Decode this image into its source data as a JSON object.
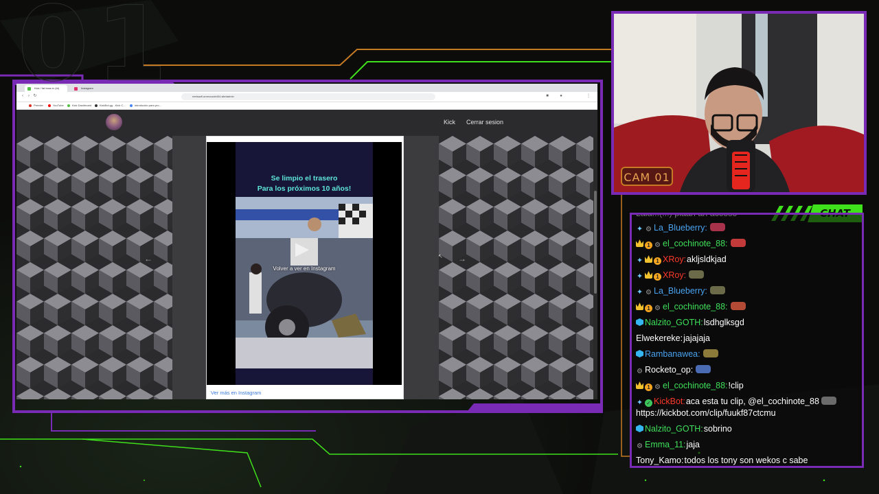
{
  "stream": {
    "overlay_number": "01",
    "cam_label": "CAM 01",
    "chat_title": "CHAT"
  },
  "browser": {
    "tabs": [
      {
        "label": "Kick / fat boss tv (bi)",
        "favicon_color": "#53c146"
      },
      {
        "label": "Instagram",
        "favicon_color": "#e1306c"
      }
    ],
    "url": "reelsazfl.unreccode404.site/admin",
    "bookmarks": [
      {
        "label": "Premier",
        "icon_color": "#d93025"
      },
      {
        "label": "YouTube",
        "icon_color": "#ff0000"
      },
      {
        "label": "Kick Dashboard",
        "icon_color": "#53c146"
      },
      {
        "label": "KickBot.gg - Kick C...",
        "icon_color": "#333333"
      },
      {
        "label": "introducido para pro...",
        "icon_color": "#4285f4"
      }
    ]
  },
  "site": {
    "nav": {
      "kick_link": "Kick",
      "logout_link": "Cerrar sesion"
    },
    "embed": {
      "video_title_line1": "Se limpio el trasero",
      "video_title_line2": "Para los próximos 10 años!",
      "watch_again": "Volver a ver en Instagram",
      "see_more": "Ver más en Instagram"
    },
    "prev_arrow": "←",
    "next_arrow": "→"
  },
  "chat": {
    "partial_top": "Lala...(...) plaan ah acceso",
    "messages": [
      {
        "badges": [
          "sword",
          "bot"
        ],
        "user": "La_Blueberry:",
        "user_color": "#4aa3f0",
        "text": "",
        "emote_color": "#a8324a"
      },
      {
        "badges": [
          "crown",
          "one",
          "bot"
        ],
        "user": "el_cochinote_88:",
        "user_color": "#3fe05a",
        "text": "",
        "emote_color": "#c23a3a"
      },
      {
        "badges": [
          "sword",
          "crown",
          "one"
        ],
        "user": "XRoy:",
        "user_color": "#ff3a2a",
        "text": "akljsldkjad",
        "emote_color": ""
      },
      {
        "badges": [
          "sword",
          "crown",
          "one"
        ],
        "user": "XRoy:",
        "user_color": "#ff3a2a",
        "text": "",
        "emote_color": "#6b6b4a"
      },
      {
        "badges": [
          "sword",
          "bot"
        ],
        "user": "La_Blueberry:",
        "user_color": "#4aa3f0",
        "text": "",
        "emote_color": "#6b6b4a"
      },
      {
        "badges": [
          "crown",
          "one",
          "bot"
        ],
        "user": "el_cochinote_88:",
        "user_color": "#3fe05a",
        "text": "",
        "emote_color": "#b24a36"
      },
      {
        "badges": [
          "cube"
        ],
        "user": "Nalzito_GOTH:",
        "user_color": "#3fe05a",
        "text": "lsdhglksgd",
        "emote_color": ""
      },
      {
        "badges": [],
        "user": "Elwekereke:",
        "user_color": "#ffffff",
        "text": "jajajaja",
        "emote_color": ""
      },
      {
        "badges": [
          "cube"
        ],
        "user": "Rambanawea:",
        "user_color": "#4aa3f0",
        "text": "",
        "emote_color": "#8b7a3a"
      },
      {
        "badges": [
          "bot"
        ],
        "user": "Rocketo_op:",
        "user_color": "#ffffff",
        "text": "",
        "emote_color": "#4a6ab2"
      },
      {
        "badges": [
          "crown",
          "one",
          "bot"
        ],
        "user": "el_cochinote_88:",
        "user_color": "#3fe05a",
        "text": "!clip",
        "emote_color": ""
      },
      {
        "badges": [
          "sword",
          "green"
        ],
        "user": "KickBot:",
        "user_color": "#ff3a2a",
        "text": "aca esta tu clip, @el_cochinote_88",
        "emote_color": "#6b6b6b",
        "continuation": "https://kickbot.com/clip/fuukf87ctcmu"
      },
      {
        "badges": [
          "cube"
        ],
        "user": "Nalzito_GOTH:",
        "user_color": "#3fe05a",
        "text": "sobrino",
        "emote_color": ""
      },
      {
        "badges": [
          "bot"
        ],
        "user": "Emma_11:",
        "user_color": "#3fe05a",
        "text": "jaja",
        "emote_color": ""
      },
      {
        "badges": [],
        "user": "Tony_Kamo:",
        "user_color": "#ffffff",
        "text": "todos los tony son wekos c sabe",
        "emote_color": ""
      }
    ]
  },
  "colors": {
    "frame_purple": "#7a2bb5",
    "accent_green": "#3fe11b",
    "accent_orange": "#c67a24"
  }
}
